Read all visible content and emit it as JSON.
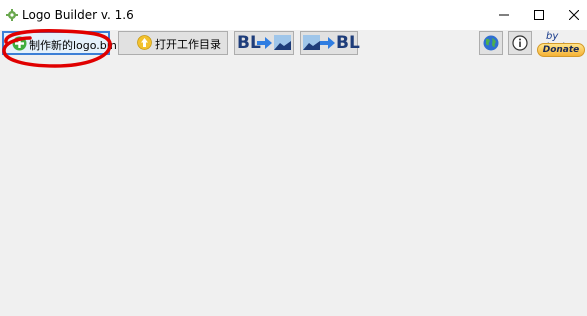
{
  "window": {
    "title": "Logo Builder v. 1.6",
    "minimize_glyph": "—",
    "maximize_glyph": "☐",
    "close_glyph": "✕"
  },
  "toolbar": {
    "new_logo_label": "制作新的logo.bin",
    "open_dir_label": "打开工作目录",
    "bl_to_image": {
      "text": "BL",
      "icon": "arrow-right-icon"
    },
    "image_to_bl": {
      "text": "BL",
      "icon": "arrow-right-icon"
    },
    "globe_icon": "globe-icon",
    "info_icon": "info-icon"
  },
  "credit": {
    "by": "by",
    "author_link": "kadan",
    "donate_label": "Donate"
  },
  "colors": {
    "accent_blue": "#3c7fd6",
    "bl_blue": "#1e3d7a",
    "annotation_red": "#e00000",
    "donate_gold": "#f5b235"
  }
}
